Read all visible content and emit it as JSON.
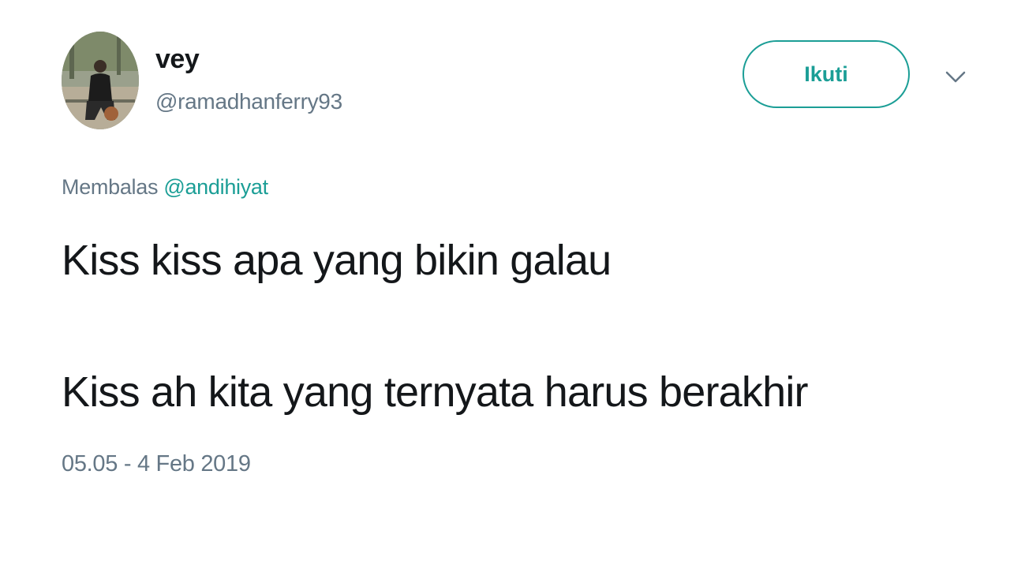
{
  "user": {
    "display_name": "vey",
    "handle": "@ramadhanferry93",
    "avatar_icon": "user-avatar-photo"
  },
  "actions": {
    "follow_label": "Ikuti",
    "menu_icon": "chevron-down-icon"
  },
  "reply": {
    "prefix": "Membalas ",
    "mention": "@andihiyat"
  },
  "tweet": {
    "line1": "Kiss kiss apa yang bikin galau",
    "line2": "Kiss ah kita yang ternyata harus berakhir"
  },
  "timestamp": "05.05 - 4 Feb 2019",
  "colors": {
    "accent": "#1b9e96",
    "text": "#14171a",
    "muted": "#657786"
  }
}
